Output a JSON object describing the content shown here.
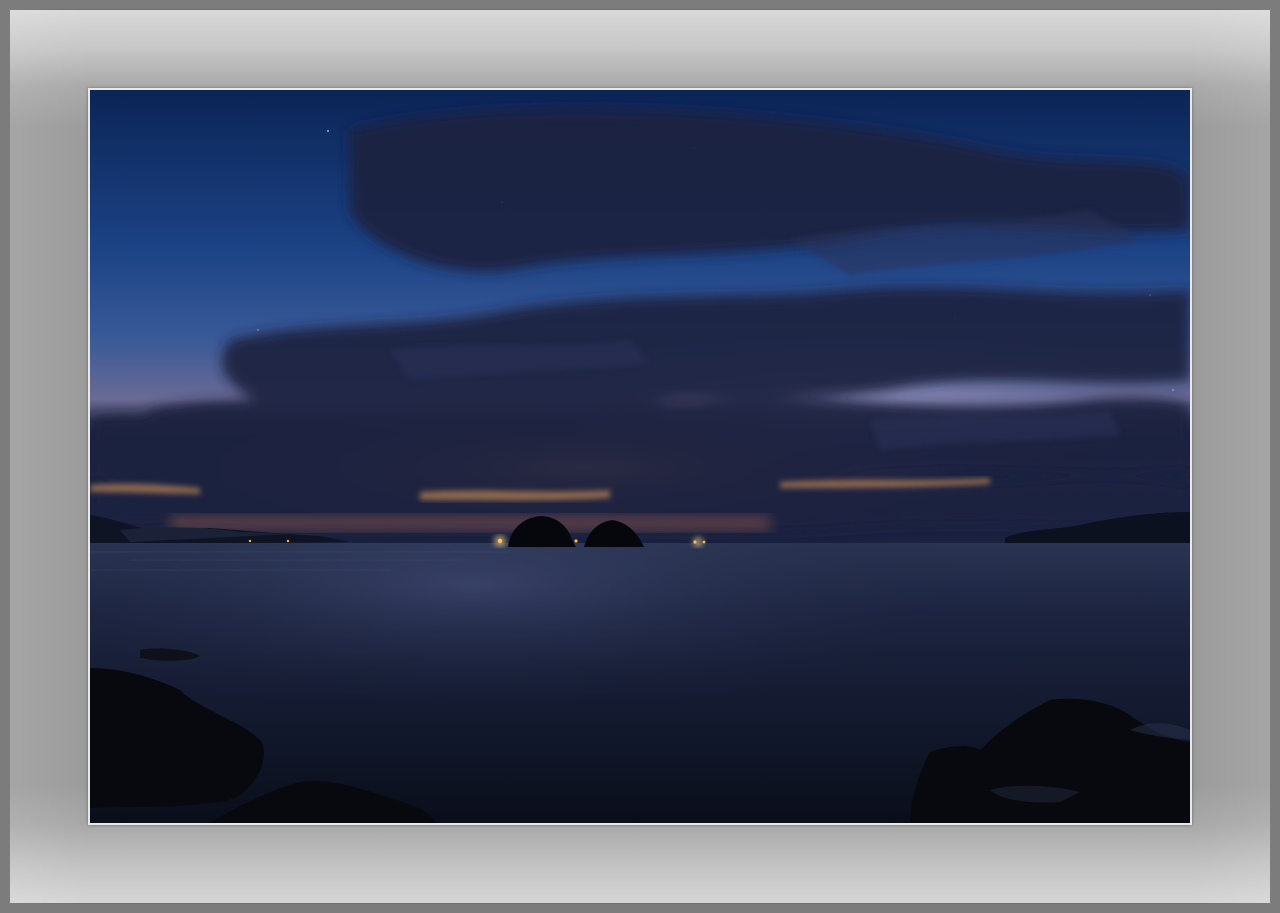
{
  "photo": {
    "subject": "coastal-night-seascape",
    "elements": [
      "night-sky",
      "cloud-layer",
      "horizon-glow",
      "distant-islands",
      "sea",
      "foreground-rocks"
    ],
    "colors": {
      "sky_top": "#0f2a5e",
      "sky_mid": "#1f4688",
      "glow": "#d98a4a",
      "clouds": "#1c2440",
      "sea": "#141a2e",
      "rock": "#07090f",
      "mat": "#9b9b9b",
      "outer_frame": "#7c7c7c"
    }
  }
}
